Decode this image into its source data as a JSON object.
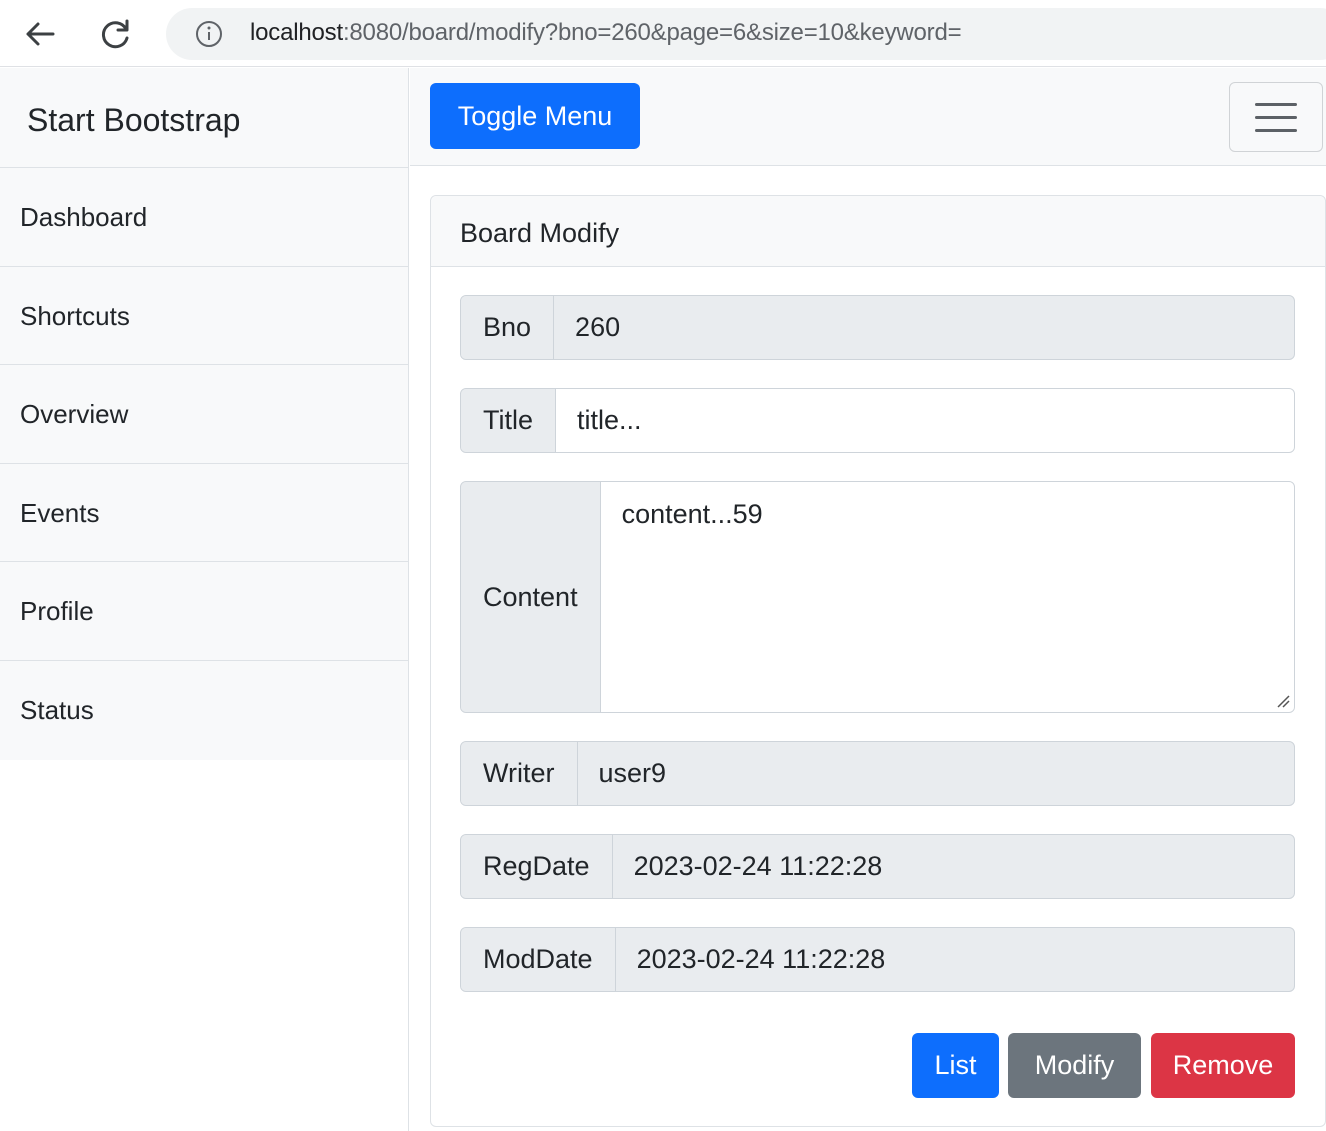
{
  "browser": {
    "url_host": "localhost",
    "url_rest": ":8080/board/modify?bno=260&page=6&size=10&keyword=",
    "icons": [
      "back-arrow-icon",
      "reload-icon",
      "info-icon"
    ]
  },
  "sidebar": {
    "heading": "Start Bootstrap",
    "items": [
      {
        "label": "Dashboard"
      },
      {
        "label": "Shortcuts"
      },
      {
        "label": "Overview"
      },
      {
        "label": "Events"
      },
      {
        "label": "Profile"
      },
      {
        "label": "Status"
      }
    ]
  },
  "topnav": {
    "toggle_label": "Toggle Menu",
    "menu_icon": "hamburger-icon"
  },
  "card": {
    "header": "Board Modify",
    "fields": {
      "bno": {
        "label": "Bno",
        "value": "260"
      },
      "title": {
        "label": "Title",
        "value": "title..."
      },
      "content": {
        "label": "Content",
        "value": "content...59"
      },
      "writer": {
        "label": "Writer",
        "value": "user9"
      },
      "regdate": {
        "label": "RegDate",
        "value": "2023-02-24 11:22:28"
      },
      "moddate": {
        "label": "ModDate",
        "value": "2023-02-24 11:22:28"
      }
    },
    "buttons": {
      "list": "List",
      "modify": "Modify",
      "remove": "Remove"
    }
  },
  "colors": {
    "primary": "#0d6efd",
    "secondary": "#6c757d",
    "danger": "#dc3545"
  }
}
